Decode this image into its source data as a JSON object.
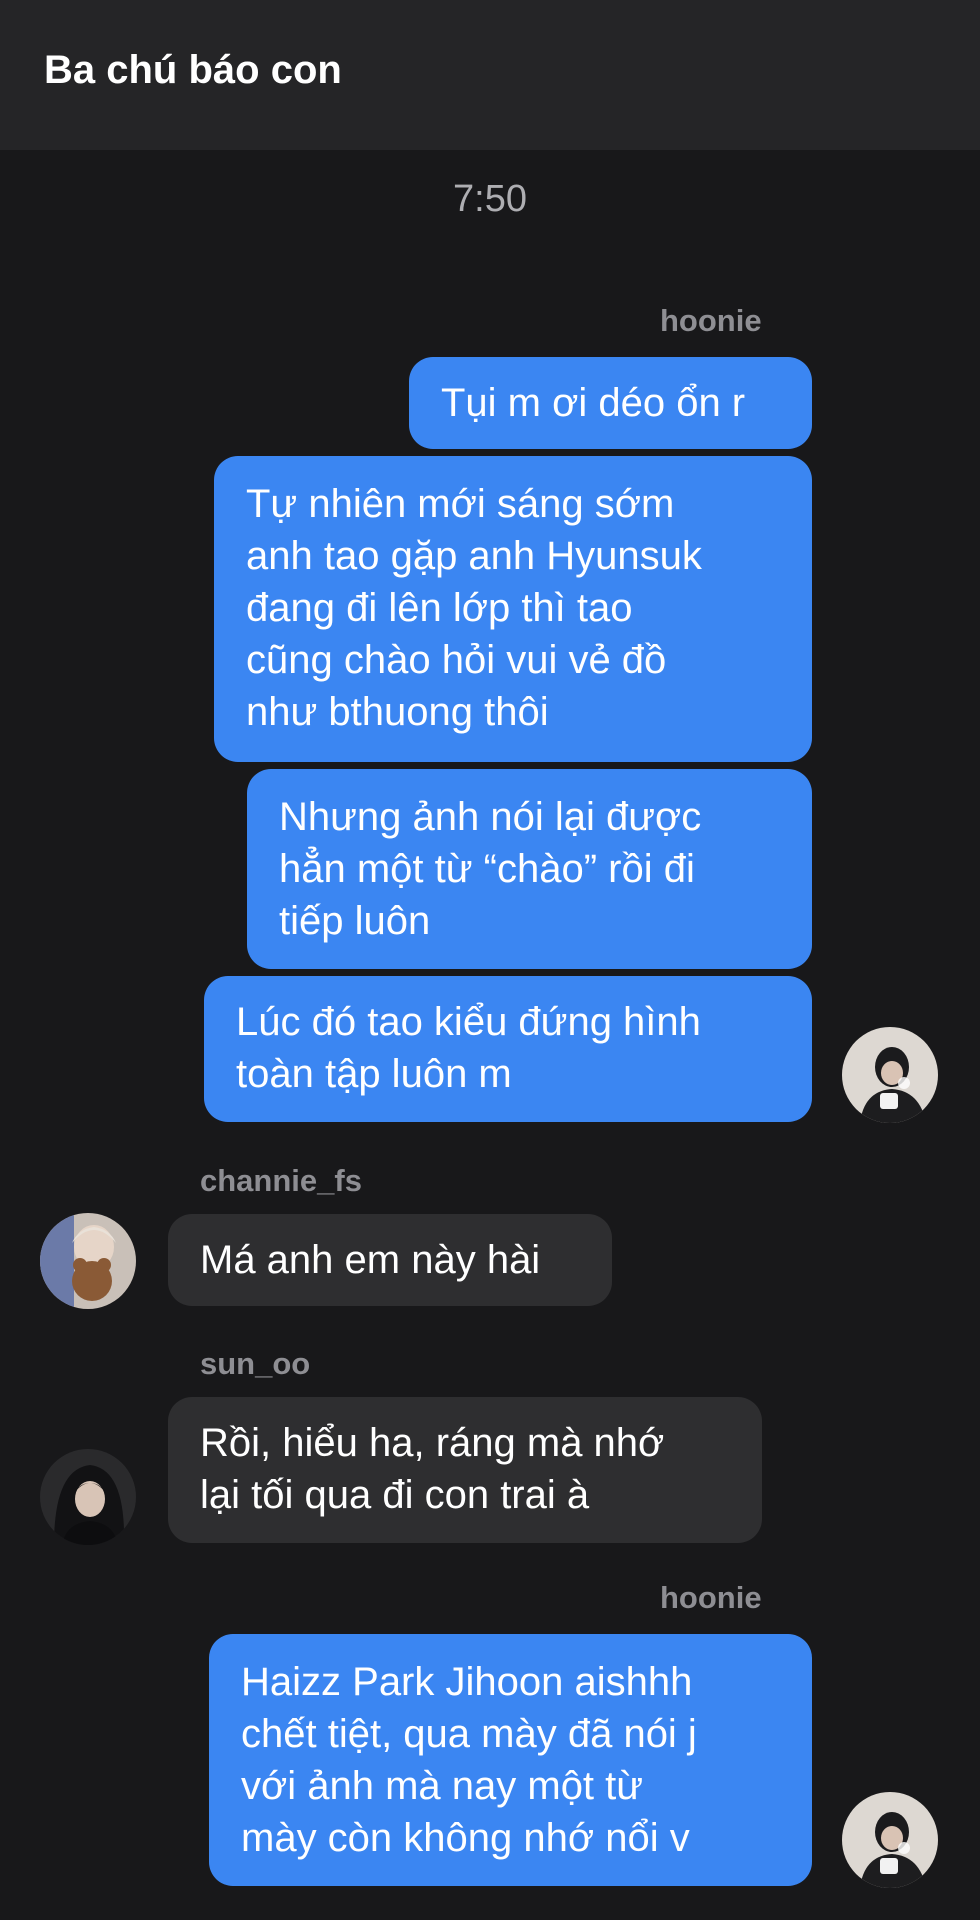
{
  "header": {
    "title": "Ba chú báo con"
  },
  "timestamp": "7:50",
  "colors": {
    "outgoing_bubble": "#3b86f2",
    "incoming_bubble": "#2e2e30",
    "background": "#18181a",
    "header": "#252527"
  },
  "messages": [
    {
      "sender": "hoonie"
    },
    {
      "lines": [
        "Tụi m ơi déo ổn r"
      ]
    },
    {
      "lines": [
        "Tự nhiên mới sáng sớm",
        "anh tao gặp anh Hyunsuk",
        "đang đi lên lớp thì tao",
        "cũng chào hỏi vui vẻ đồ",
        "như bthuong thôi"
      ]
    },
    {
      "lines": [
        "Nhưng ảnh nói lại được",
        "hẳn một từ “chào” rồi đi",
        "tiếp luôn"
      ]
    },
    {
      "lines": [
        "Lúc đó tao kiểu đứng hình",
        "toàn tập luôn m"
      ]
    },
    {
      "sender": "channie_fs",
      "lines": [
        "Má anh em này hài"
      ]
    },
    {
      "sender": "sun_oo",
      "lines": [
        "Rồi, hiểu ha, ráng mà nhớ",
        "lại tối qua đi con trai à"
      ]
    },
    {
      "sender": "hoonie",
      "lines": [
        "Haizz Park Jihoon aishhh",
        "chết tiệt, qua mày đã nói j",
        "với ảnh mà nay một từ",
        "mày còn không nhớ nổi v"
      ]
    }
  ],
  "avatars": {
    "hoonie": "avatar-hoonie",
    "channie_fs": "avatar-channie",
    "sun_oo": "avatar-sunoo"
  }
}
